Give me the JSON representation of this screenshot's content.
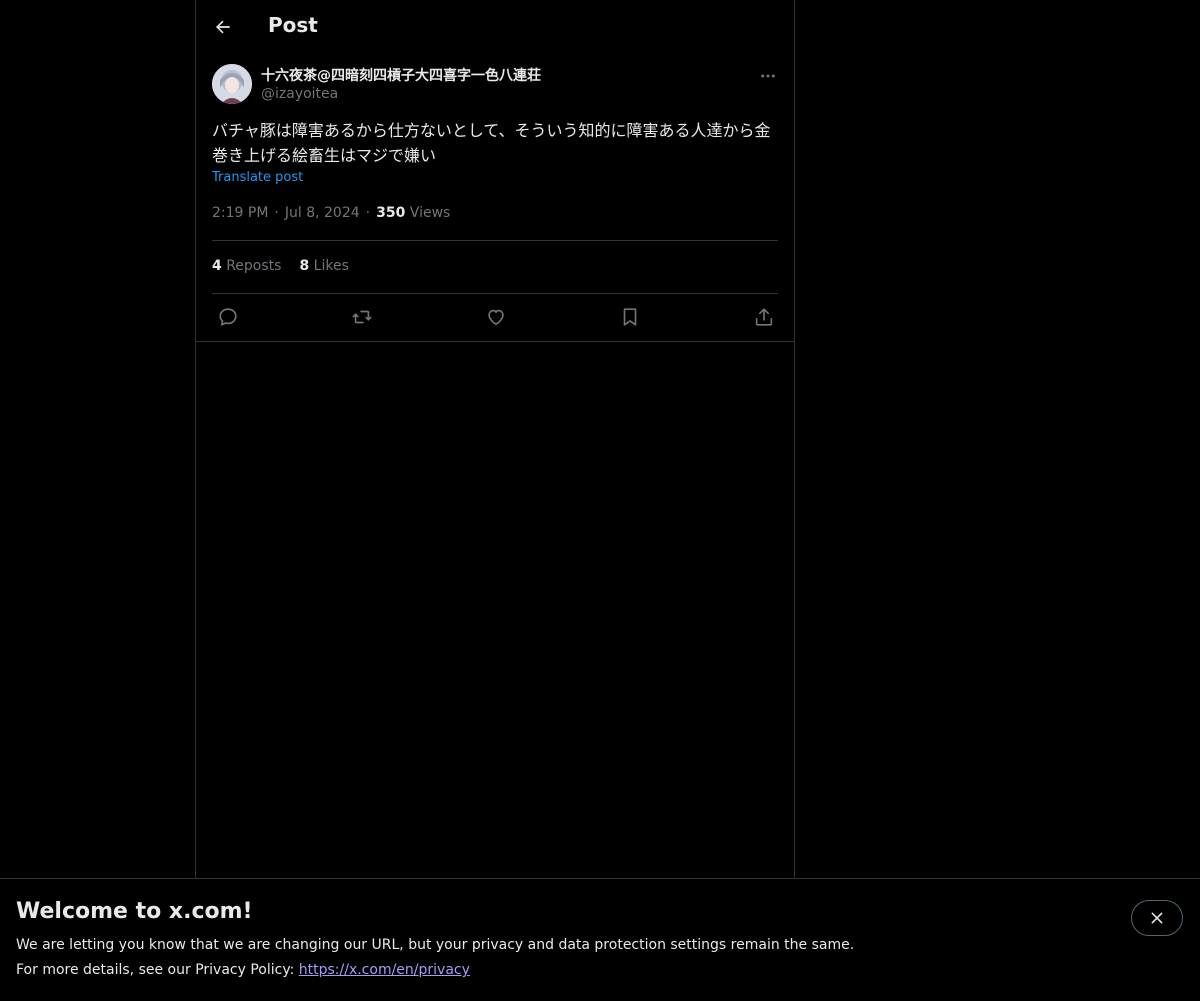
{
  "header": {
    "title": "Post"
  },
  "post": {
    "display_name": "十六夜茶@四暗刻四槓子大四喜字一色八連荘",
    "handle": "@izayoitea",
    "text": "バチャ豚は障害あるから仕方ないとして、そういう知的に障害ある人達から金巻き上げる絵畜生はマジで嫌い",
    "translate_label": "Translate post",
    "time": "2:19 PM",
    "date": "Jul 8, 2024",
    "views_count": "350",
    "views_label": "Views",
    "separator": "·"
  },
  "stats": {
    "reposts_count": "4",
    "reposts_label": "Reposts",
    "likes_count": "8",
    "likes_label": "Likes"
  },
  "actions": [
    "reply-icon",
    "repost-icon",
    "like-icon",
    "bookmark-icon",
    "share-icon"
  ],
  "banner": {
    "title": "Welcome to x.com!",
    "line1": "We are letting you know that we are changing our URL, but your privacy and data protection settings remain the same.",
    "line2_prefix": "For more details, see our Privacy Policy: ",
    "link": "https://x.com/en/privacy"
  },
  "colors": {
    "background": "#000000",
    "text": "#e7e9ea",
    "muted": "#71767b",
    "accent": "#1d9bf0",
    "border": "#2f3336"
  }
}
